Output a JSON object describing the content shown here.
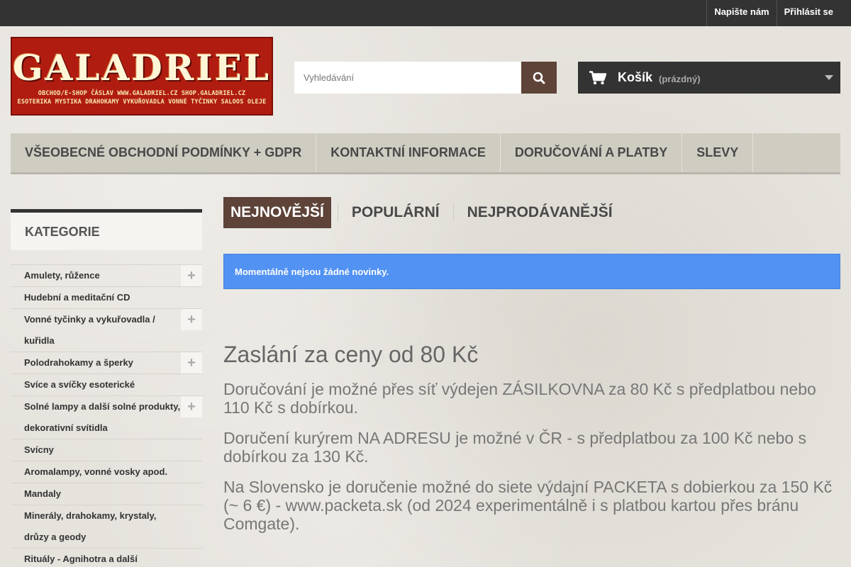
{
  "topbar": {
    "contact_label": "Napište nám",
    "login_label": "Přihlásit se"
  },
  "logo": {
    "wordmark": "GALADRIEL",
    "line1": "OBCHOD/E-SHOP ČÁSLAV   WWW.GALADRIEL.CZ   SHOP.GALADRIEL.CZ",
    "line2": "ESOTERIKA MYSTIKA   DRAHOKAMY VYKUŘOVADLA   VONNÉ TYČINKY SALOOS OLEJE"
  },
  "search": {
    "placeholder": "Vyhledávání",
    "icon": "search-icon"
  },
  "cart": {
    "title": "Košík",
    "status": "(prázdný)",
    "icon": "cart-icon"
  },
  "menu": {
    "items": [
      "VŠEOBECNÉ OBCHODNÍ PODMÍNKY + GDPR",
      "KONTAKTNÍ INFORMACE",
      "DORUČOVÁNÍ A PLATBY",
      "SLEVY"
    ]
  },
  "sidebar": {
    "heading": "KATEGORIE",
    "categories": [
      {
        "label": "Amulety, růžence",
        "expandable": true
      },
      {
        "label": "Hudební a meditační CD",
        "expandable": false
      },
      {
        "label": "Vonné tyčinky a vykuřovadla / kuřidla",
        "expandable": true
      },
      {
        "label": "Polodrahokamy a šperky",
        "expandable": true
      },
      {
        "label": "Svíce a svíčky esoterické",
        "expandable": false
      },
      {
        "label": "Solné lampy a další solné produkty, dekorativní svítidla",
        "expandable": true
      },
      {
        "label": "Svícny",
        "expandable": false
      },
      {
        "label": "Aromalampy, vonné vosky apod.",
        "expandable": false
      },
      {
        "label": "Mandaly",
        "expandable": false
      },
      {
        "label": "Minerály, drahokamy, krystaly, drůzy a geody",
        "expandable": false
      },
      {
        "label": "Rituály - Agnihotra a další",
        "expandable": false
      }
    ]
  },
  "tabs": {
    "items": [
      "NEJNOVĚJŠÍ",
      "POPULÁRNÍ",
      "NEJPRODÁVANĚJŠÍ"
    ],
    "active": 0
  },
  "alert": {
    "text": "Momentálně nejsou žádné novinky."
  },
  "shipping": {
    "heading": "Zaslání za ceny od 80 Kč",
    "p1": "Doručování je možné přes síť výdejen ZÁSILKOVNA za 80 Kč s předplatbou nebo 110 Kč s dobírkou.",
    "p2": "Doručení kurýrem NA ADRESU je možné v ČR - s předplatbou za 100 Kč nebo s dobírkou za 130 Kč.",
    "p3": "Na Slovensko je doručenie možné do siete výdajní PACKETA s dobierkou za 150 Kč (~ 6 €) - www.packeta.sk (od 2024 experimentálně i s platbou kartou přes bránu Comgate)."
  },
  "colors": {
    "topbar": "#333333",
    "brand_red": "#b01d10",
    "search_button": "#5e4338",
    "active_tab": "#5e4338",
    "alert_blue": "#5192f3",
    "menu_bg": "#cfcdc2"
  }
}
